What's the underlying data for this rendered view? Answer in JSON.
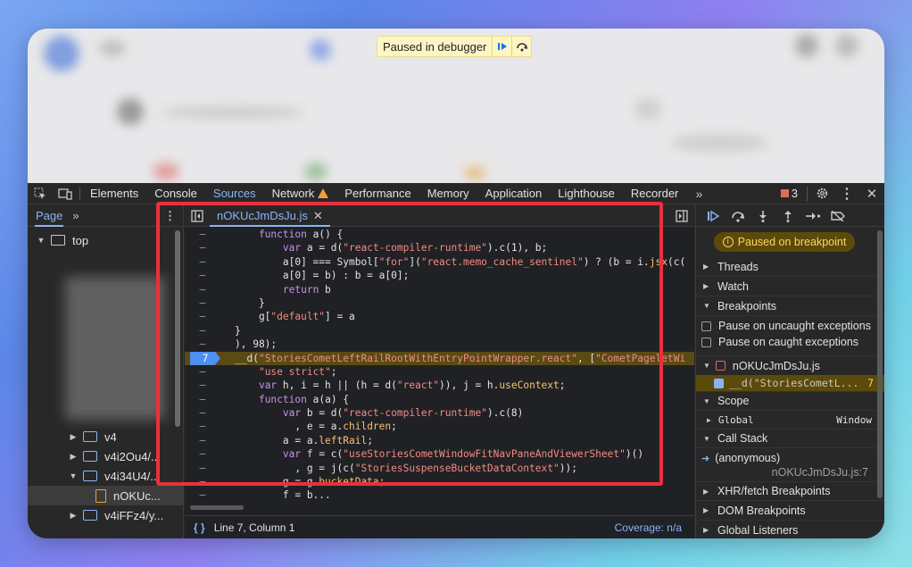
{
  "pause_bar": {
    "text": "Paused in debugger"
  },
  "tabs": [
    "Elements",
    "Console",
    "Sources",
    "Network",
    "Performance",
    "Memory",
    "Application",
    "Lighthouse",
    "Recorder"
  ],
  "active_tab": "Sources",
  "error_count": "3",
  "navigator": {
    "tab": "Page",
    "items": [
      {
        "label": "top",
        "depth": 0,
        "kind": "frame",
        "expanded": true
      },
      {
        "label": "v4",
        "depth": 3,
        "kind": "folder",
        "expanded": false
      },
      {
        "label": "v4i2Ou4/...",
        "depth": 3,
        "kind": "folder",
        "expanded": false
      },
      {
        "label": "v4i34U4/...",
        "depth": 3,
        "kind": "folder",
        "expanded": true
      },
      {
        "label": "nOKUc...",
        "depth": 4,
        "kind": "file",
        "selected": true
      },
      {
        "label": "v4iFFz4/y...",
        "depth": 3,
        "kind": "folder",
        "expanded": false
      }
    ]
  },
  "editor": {
    "file_tab": "nOKUcJmDsJu.js",
    "lines": [
      {
        "gutter": "–",
        "html": "    <span class=\"kw\">function</span> <span class=\"fn\">a</span>() {"
      },
      {
        "gutter": "–",
        "html": "        <span class=\"kw\">var</span> a = d(<span class=\"str\">\"react-compiler-runtime\"</span>).c(1), b;"
      },
      {
        "gutter": "–",
        "html": "        a[0] === Symbol[<span class=\"str\">\"for\"</span>](<span class=\"str\">\"react.memo_cache_sentinel\"</span>) ? (b = i.<span class=\"prop\">jsx</span>(c("
      },
      {
        "gutter": "–",
        "html": "        a[0] = b) : b = a[0];"
      },
      {
        "gutter": "–",
        "html": "        <span class=\"kw\">return</span> b"
      },
      {
        "gutter": "–",
        "html": "    }"
      },
      {
        "gutter": "–",
        "html": "    g[<span class=\"str\">\"default\"</span>] = a"
      },
      {
        "gutter": "–",
        "html": "}"
      },
      {
        "gutter": "–",
        "html": "), 98);"
      },
      {
        "gutter": "7",
        "html": "__d(<span class=\"str\">\"StoriesCometLeftRailRootWithEntryPointWrapper.react\"</span>, [<span class=\"str\">\"CometPageletWi</span>",
        "breakpoint": true,
        "paused": true
      },
      {
        "gutter": "–",
        "html": "    <span class=\"str\">\"use strict\"</span>;"
      },
      {
        "gutter": "–",
        "html": "    <span class=\"kw\">var</span> h, i = h || (h = d(<span class=\"str\">\"react\"</span>)), j = h.<span class=\"prop\">useContext</span>;"
      },
      {
        "gutter": "–",
        "html": "    <span class=\"kw\">function</span> <span class=\"fn\">a</span>(a) {"
      },
      {
        "gutter": "–",
        "html": "        <span class=\"kw\">var</span> b = d(<span class=\"str\">\"react-compiler-runtime\"</span>).c(8)"
      },
      {
        "gutter": "–",
        "html": "          , e = a.<span class=\"prop\">children</span>;"
      },
      {
        "gutter": "–",
        "html": "        a = a.<span class=\"prop\">leftRail</span>;"
      },
      {
        "gutter": "–",
        "html": "        <span class=\"kw\">var</span> f = c(<span class=\"str\">\"useStoriesCometWindowFitNavPaneAndViewerSheet\"</span>)()"
      },
      {
        "gutter": "–",
        "html": "          , g = j(c(<span class=\"str\">\"StoriesSuspenseBucketDataContext\"</span>));"
      },
      {
        "gutter": "–",
        "html": "        g = g.<span class=\"prop\">bucketData</span>;"
      },
      {
        "gutter": "–",
        "html": "        f = b..."
      }
    ],
    "status": "Line 7, Column 1",
    "coverage": "Coverage: n/a"
  },
  "debugger": {
    "pill": "Paused on breakpoint",
    "sections": {
      "threads": "Threads",
      "watch": "Watch",
      "breakpoints": "Breakpoints",
      "scope": "Scope",
      "call_stack": "Call Stack",
      "xhr": "XHR/fetch Breakpoints",
      "dom": "DOM Breakpoints",
      "global_listeners": "Global Listeners"
    },
    "pause_uncaught": "Pause on uncaught exceptions",
    "pause_caught": "Pause on caught exceptions",
    "bp_file": "nOKUcJmDsJu.js",
    "bp_entry": "__d(\"StoriesCometL...",
    "bp_line": "7",
    "scope_global": "Global",
    "scope_global_value": "Window",
    "stack_fn": "(anonymous)",
    "stack_loc": "nOKUcJmDsJu.js:7"
  }
}
